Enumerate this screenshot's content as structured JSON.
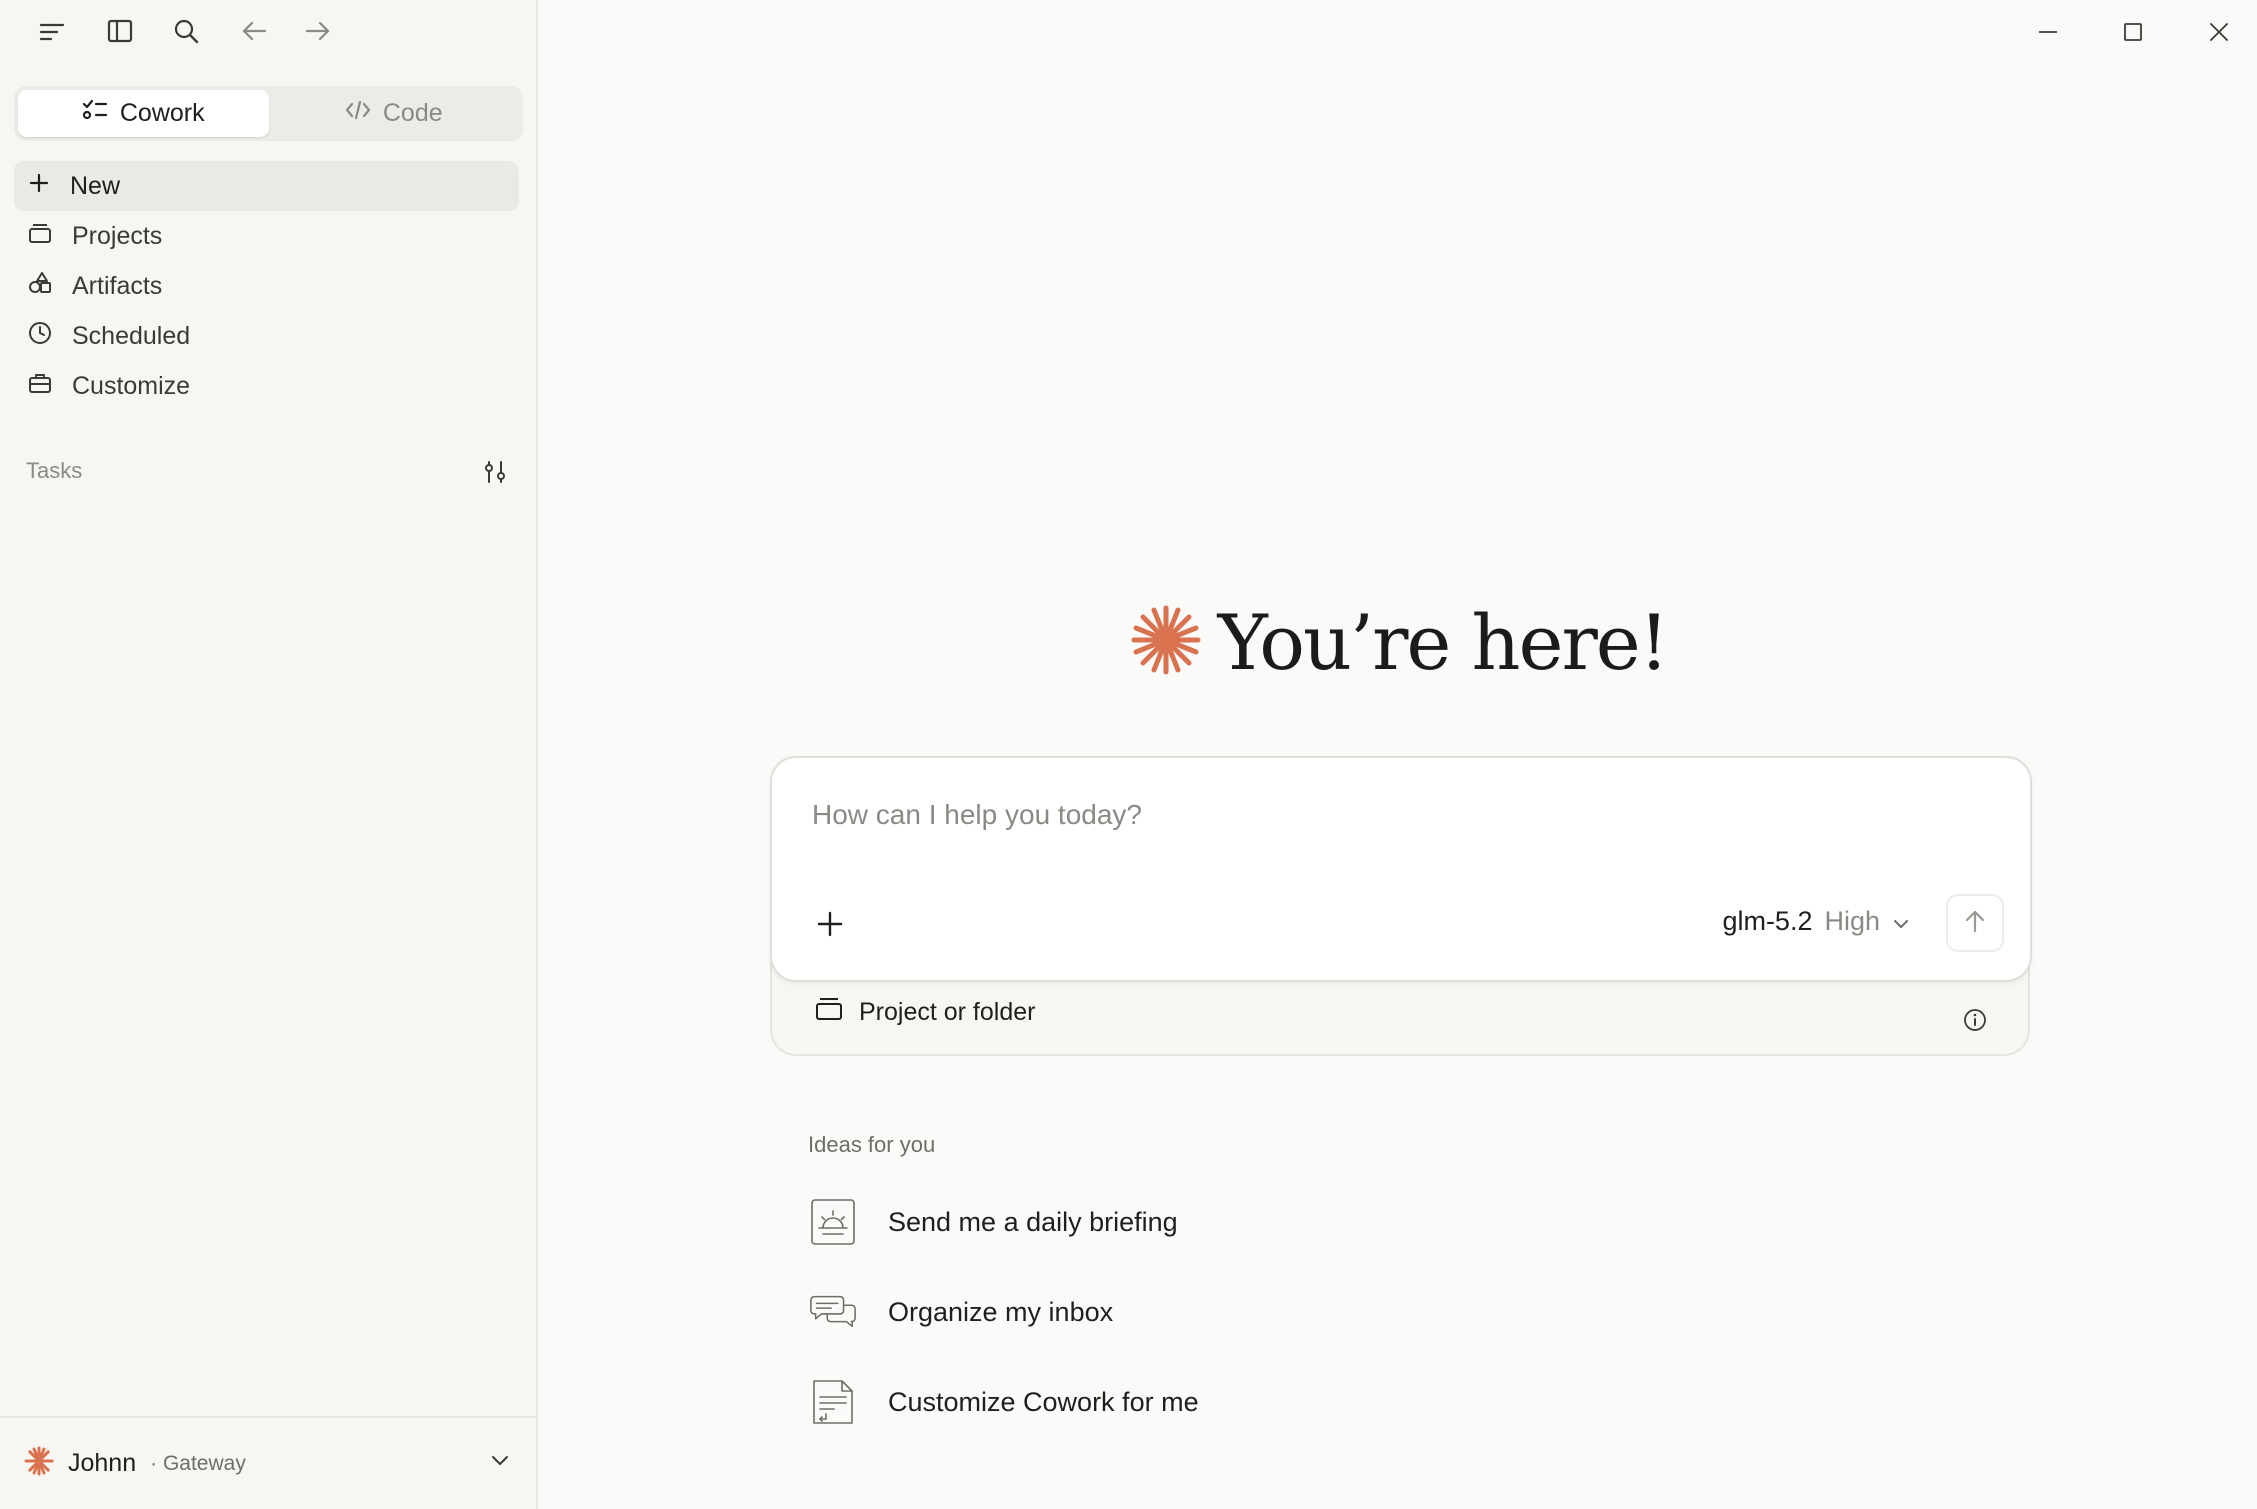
{
  "mode_tabs": [
    {
      "label": "Cowork",
      "icon": "checklist-icon"
    },
    {
      "label": "Code",
      "icon": "code-icon"
    }
  ],
  "nav": {
    "items": [
      {
        "label": "New",
        "icon": "plus-icon"
      },
      {
        "label": "Projects",
        "icon": "folder-icon"
      },
      {
        "label": "Artifacts",
        "icon": "shapes-icon"
      },
      {
        "label": "Scheduled",
        "icon": "clock-icon"
      },
      {
        "label": "Customize",
        "icon": "briefcase-icon"
      }
    ]
  },
  "tasks": {
    "label": "Tasks"
  },
  "user": {
    "name": "Johnn",
    "org": "· Gateway"
  },
  "hero": {
    "title": "You’re here!"
  },
  "composer": {
    "placeholder": "How can I help you today?",
    "model": "glm-5.2",
    "effort": "High",
    "project_label": "Project or folder"
  },
  "ideas": {
    "label": "Ideas for you",
    "items": [
      {
        "label": "Send me a daily briefing",
        "icon": "sunrise-icon"
      },
      {
        "label": "Organize my inbox",
        "icon": "inbox-icon"
      },
      {
        "label": "Customize Cowork for me",
        "icon": "document-icon"
      }
    ]
  },
  "colors": {
    "accent": "#d9734f",
    "background": "#fafaf8",
    "sidebar": "#f7f6f3"
  }
}
